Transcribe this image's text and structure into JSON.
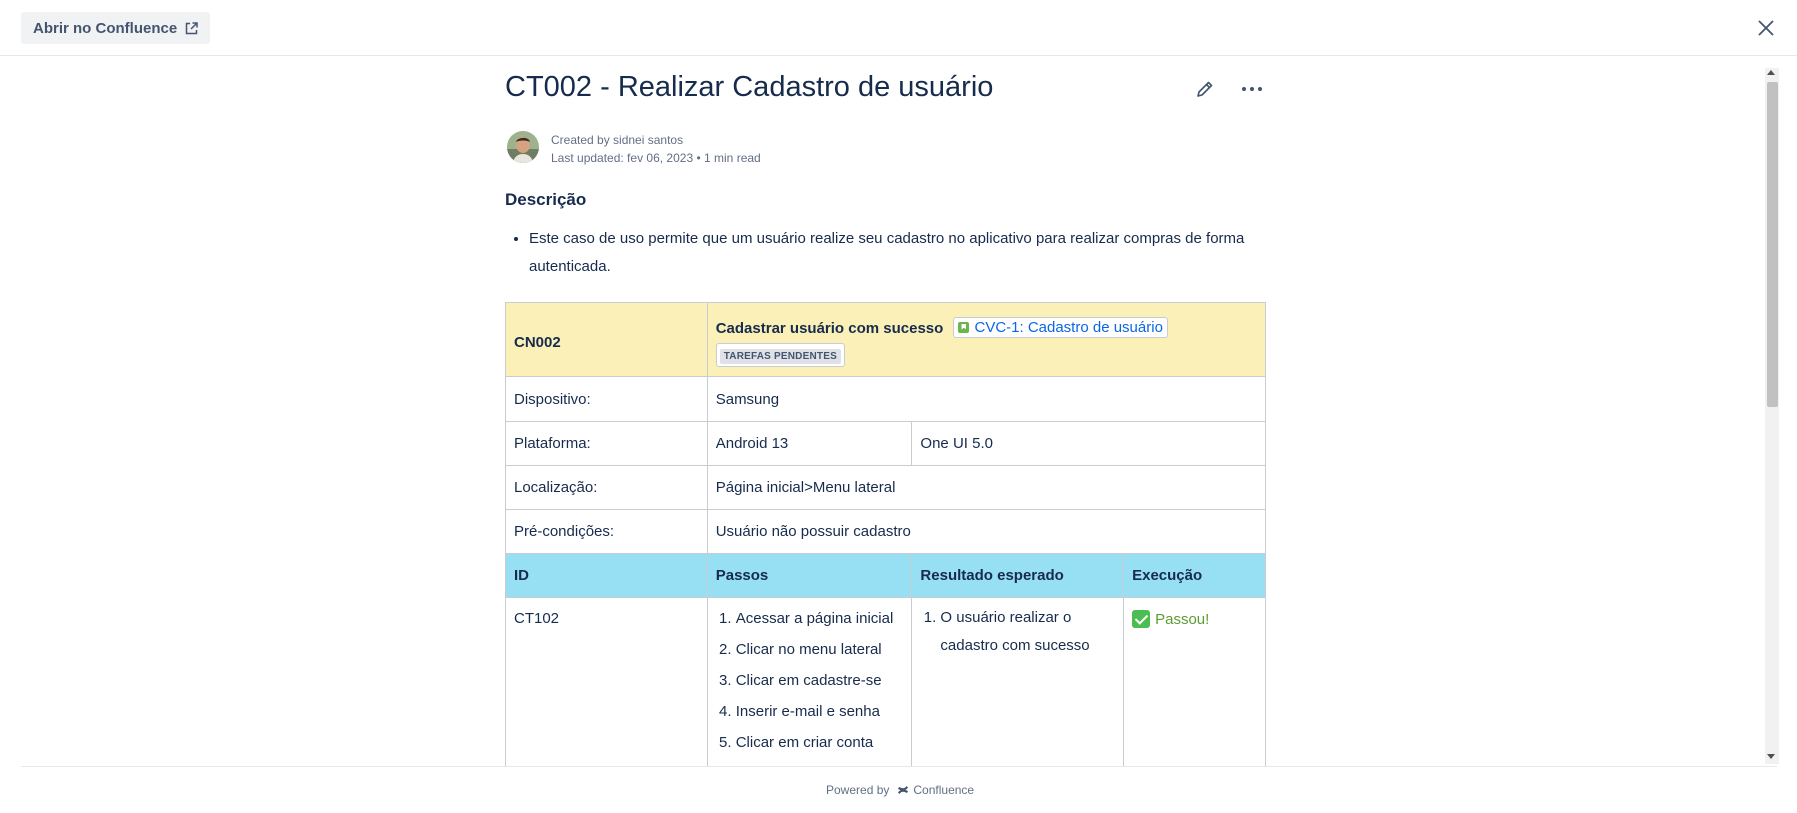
{
  "header": {
    "open_label": "Abrir no Confluence",
    "open_icon": "external-link-icon",
    "close_icon": "close-icon"
  },
  "page": {
    "title": "CT002 - Realizar Cadastro de usuário",
    "created_by": "Created by sidnei santos",
    "last_updated": "Last updated: fev 06, 2023",
    "read_time": "1 min read",
    "section_heading": "Descrição",
    "description": "Este caso de uso permite que um usuário realize seu cadastro no aplicativo para realizar compras de forma autenticada."
  },
  "table": {
    "cn_id": "CN002",
    "cn_title": "Cadastrar usuário com sucesso",
    "jira_link": "CVC-1: Cadastro de usuário",
    "status": "TAREFAS PENDENTES",
    "rows": {
      "device_label": "Dispositivo:",
      "device_value": "Samsung",
      "platform_label": "Plataforma:",
      "platform_os": "Android 13",
      "platform_ui": "One UI 5.0",
      "location_label": "Localização:",
      "location_value": "Página inicial>Menu lateral",
      "precond_label": "Pré-condições:",
      "precond_value": "Usuário não possuir cadastro"
    },
    "headers": {
      "id": "ID",
      "steps": "Passos",
      "expected": "Resultado esperado",
      "execution": "Execução"
    },
    "case": {
      "id": "CT102",
      "steps": [
        "Acessar a página inicial",
        "Clicar no menu lateral",
        "Clicar em cadastre-se",
        "Inserir e-mail e senha",
        "Clicar em criar conta"
      ],
      "expected": [
        "O usuário realizar o cadastro com sucesso"
      ],
      "execution": "Passou!"
    }
  },
  "footer": {
    "powered_by": "Powered by",
    "brand": "Confluence"
  },
  "colors": {
    "cn_row": "#fbf0b7",
    "header_row": "#97dff2",
    "link": "#0c66e4",
    "pass": "#5c9d33"
  }
}
